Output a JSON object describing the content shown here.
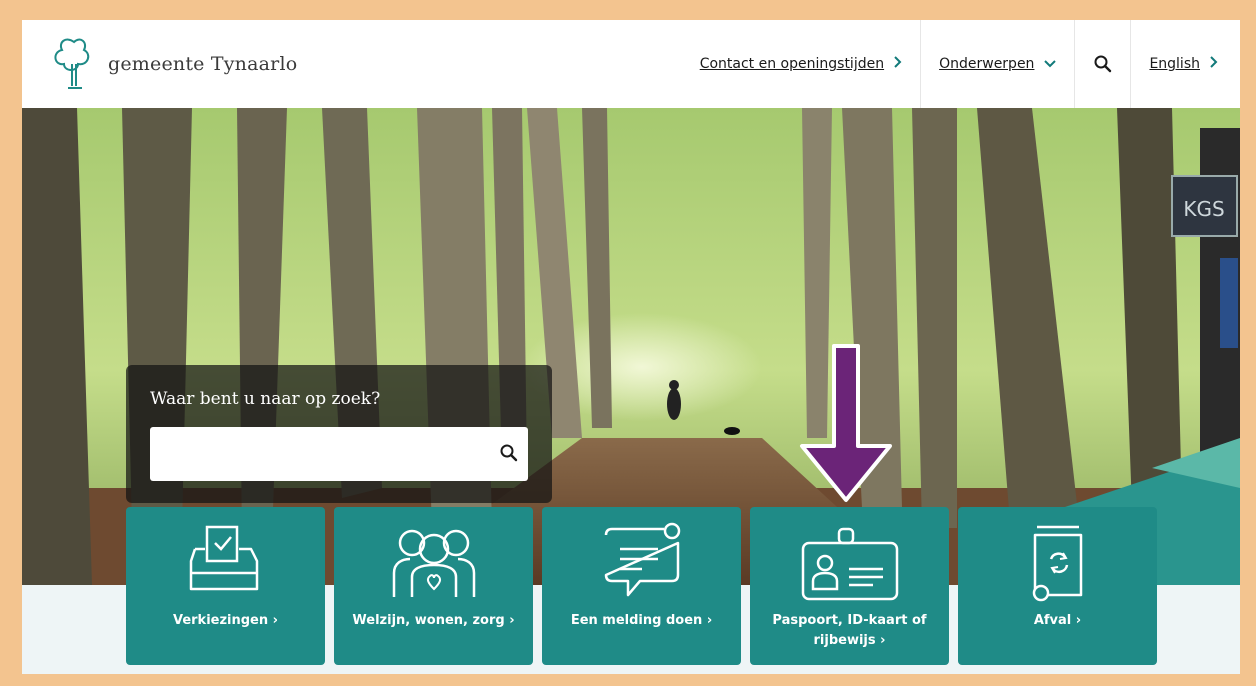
{
  "header": {
    "logo_text": "gemeente Tynaarlo",
    "nav": {
      "contact": "Contact en openingstijden",
      "topics": "Onderwerpen",
      "language": "English"
    }
  },
  "hero": {
    "search": {
      "title": "Waar bent u naar op zoek?",
      "placeholder": ""
    },
    "sign_text": "KGS"
  },
  "tiles": [
    {
      "label": "Verkiezingen",
      "icon": "ballot-box-icon"
    },
    {
      "label": "Welzijn, wonen, zorg",
      "icon": "people-heart-icon"
    },
    {
      "label": "Een melding doen",
      "icon": "message-notification-icon"
    },
    {
      "label": "Paspoort, ID-kaart of rijbewijs",
      "icon": "id-card-icon"
    },
    {
      "label": "Afval",
      "icon": "recycle-bin-icon"
    }
  ],
  "colors": {
    "teal": "#1f8b87",
    "accent_teal": "#127a7a",
    "frame": "#f3c48f",
    "arrow": "#6b2478"
  }
}
